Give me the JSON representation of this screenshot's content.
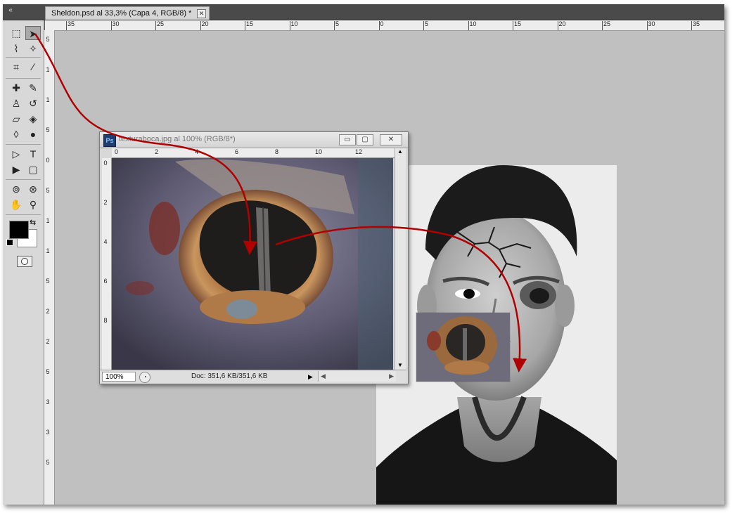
{
  "app": {
    "collapse_icon": "double-chevron-left-icon",
    "collapse_glyph": "«"
  },
  "document_tab": {
    "title": "Sheldon.psd al 33,3% (Capa 4, RGB/8) *",
    "close_glyph": "✕"
  },
  "toolbox": {
    "foreground_color": "#000000",
    "background_color": "#ffffff",
    "tools": [
      {
        "name": "marquee-tool-icon",
        "glyph": "⬚"
      },
      {
        "name": "move-tool-icon",
        "glyph": "➤",
        "active": true
      },
      {
        "name": "lasso-tool-icon",
        "glyph": "⌇"
      },
      {
        "name": "magic-wand-tool-icon",
        "glyph": "✧"
      },
      {
        "name": "crop-tool-icon",
        "glyph": "⌗"
      },
      {
        "name": "eyedropper-tool-icon",
        "glyph": "⁄"
      },
      {
        "name": "healing-brush-tool-icon",
        "glyph": "✚"
      },
      {
        "name": "brush-tool-icon",
        "glyph": "✎"
      },
      {
        "name": "clone-stamp-tool-icon",
        "glyph": "♙"
      },
      {
        "name": "history-brush-tool-icon",
        "glyph": "↺"
      },
      {
        "name": "eraser-tool-icon",
        "glyph": "▱"
      },
      {
        "name": "paint-bucket-tool-icon",
        "glyph": "◈"
      },
      {
        "name": "blur-tool-icon",
        "glyph": "◊"
      },
      {
        "name": "dodge-tool-icon",
        "glyph": "●"
      },
      {
        "name": "pen-tool-icon",
        "glyph": "▷"
      },
      {
        "name": "type-tool-icon",
        "glyph": "T"
      },
      {
        "name": "path-selection-tool-icon",
        "glyph": "▶"
      },
      {
        "name": "shape-tool-icon",
        "glyph": "▢"
      },
      {
        "name": "3d-rotate-tool-icon",
        "glyph": "⊚"
      },
      {
        "name": "3d-orbit-tool-icon",
        "glyph": "⊛"
      },
      {
        "name": "hand-tool-icon",
        "glyph": "✋"
      },
      {
        "name": "zoom-tool-icon",
        "glyph": "⚲"
      }
    ]
  },
  "main_ruler": {
    "top_labels": [
      "35",
      "30",
      "25",
      "20",
      "15",
      "10",
      "5",
      "0",
      "5",
      "10",
      "15",
      "20",
      "25",
      "30",
      "35"
    ],
    "left_labels": [
      "5",
      "1",
      "1",
      "5",
      "0",
      "5",
      "1",
      "1",
      "5",
      "2",
      "2",
      "5",
      "3",
      "3",
      "5"
    ]
  },
  "floating_window": {
    "title": "texturaboca.jpg al 100% (RGB/8*)",
    "minimize_glyph": "▭",
    "restore_glyph": "▢",
    "close_glyph": "✕",
    "ruler_top_labels": [
      "0",
      "2",
      "4",
      "6",
      "8",
      "10",
      "12"
    ],
    "ruler_left_labels": [
      "0",
      "2",
      "4",
      "6",
      "8"
    ],
    "zoom": "100%",
    "doc_size": "Doc: 351,6 KB/351,6 KB",
    "status_arrow_glyph": "▶",
    "hscroll_left_glyph": "◀",
    "hscroll_right_glyph": "▶",
    "vscroll_up_glyph": "▲",
    "vscroll_down_glyph": "▼"
  }
}
